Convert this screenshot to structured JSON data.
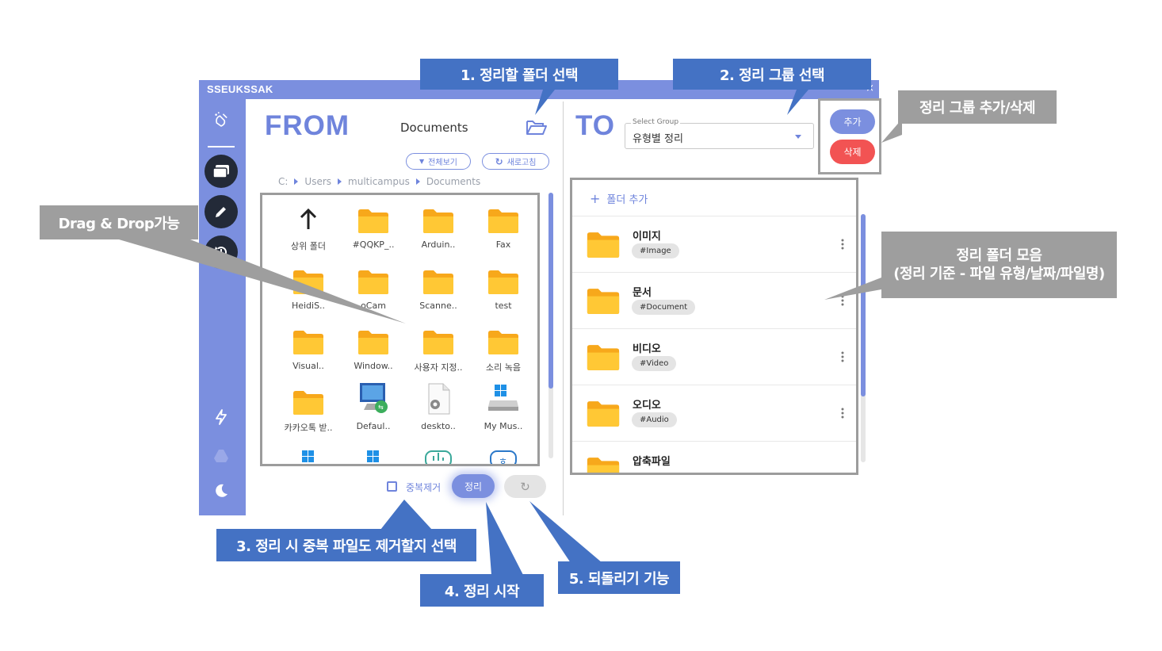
{
  "app": {
    "title": "SSEUKSSAK"
  },
  "from": {
    "heading": "FROM",
    "current_folder": "Documents",
    "view_all_label": "전체보기",
    "refresh_label": "새로고침",
    "breadcrumb": [
      "C:",
      "Users",
      "multicampus",
      "Documents"
    ],
    "items": [
      {
        "label": "상위 폴더",
        "icon": "up-arrow-icon"
      },
      {
        "label": "#QQKP_..",
        "icon": "folder-icon"
      },
      {
        "label": "Arduin..",
        "icon": "folder-icon"
      },
      {
        "label": "Fax",
        "icon": "folder-icon"
      },
      {
        "label": "HeidiS..",
        "icon": "folder-icon"
      },
      {
        "label": "oCam",
        "icon": "folder-icon"
      },
      {
        "label": "Scanne..",
        "icon": "folder-icon"
      },
      {
        "label": "test",
        "icon": "folder-icon"
      },
      {
        "label": "Visual..",
        "icon": "folder-icon"
      },
      {
        "label": "Window..",
        "icon": "folder-icon"
      },
      {
        "label": "사용자 지정..",
        "icon": "folder-icon"
      },
      {
        "label": "소리 녹음",
        "icon": "folder-icon"
      },
      {
        "label": "카카오톡 받..",
        "icon": "folder-icon"
      },
      {
        "label": "Defaul..",
        "icon": "remote-desktop-icon"
      },
      {
        "label": "deskto..",
        "icon": "settings-file-icon"
      },
      {
        "label": "My Mus..",
        "icon": "windows-drive-icon"
      }
    ],
    "dedupe_label": "중복제거",
    "organize_label": "정리"
  },
  "to": {
    "heading": "TO",
    "select_legend": "Select Group",
    "select_value": "유형별 정리",
    "add_label": "추가",
    "delete_label": "삭제",
    "add_folder_label": "폴더 추가",
    "folders": [
      {
        "name": "이미지",
        "tag": "#Image"
      },
      {
        "name": "문서",
        "tag": "#Document"
      },
      {
        "name": "비디오",
        "tag": "#Video"
      },
      {
        "name": "오디오",
        "tag": "#Audio"
      },
      {
        "name": "압축파일",
        "tag": ""
      }
    ]
  },
  "annotations": {
    "a1": "1. 정리할 폴더 선택",
    "a2": "2. 정리 그룹 선택",
    "a_group": "정리 그룹 추가/삭제",
    "a_drag": "Drag & Drop가능",
    "a_folders_l1": "정리 폴더 모음",
    "a_folders_l2": "(정리 기준 - 파일 유형/날짜/파일명)",
    "a3": "3. 정리 시 중복 파일도 제거할지 선택",
    "a4": "4. 정리 시작",
    "a5": "5. 되돌리기 기능"
  },
  "colors": {
    "accent": "#7b8fdf",
    "dark": "#232a38",
    "danger": "#f25353",
    "callout_blue": "#4472c4",
    "callout_gray": "#9e9e9e",
    "folder": "#ffc42e"
  }
}
